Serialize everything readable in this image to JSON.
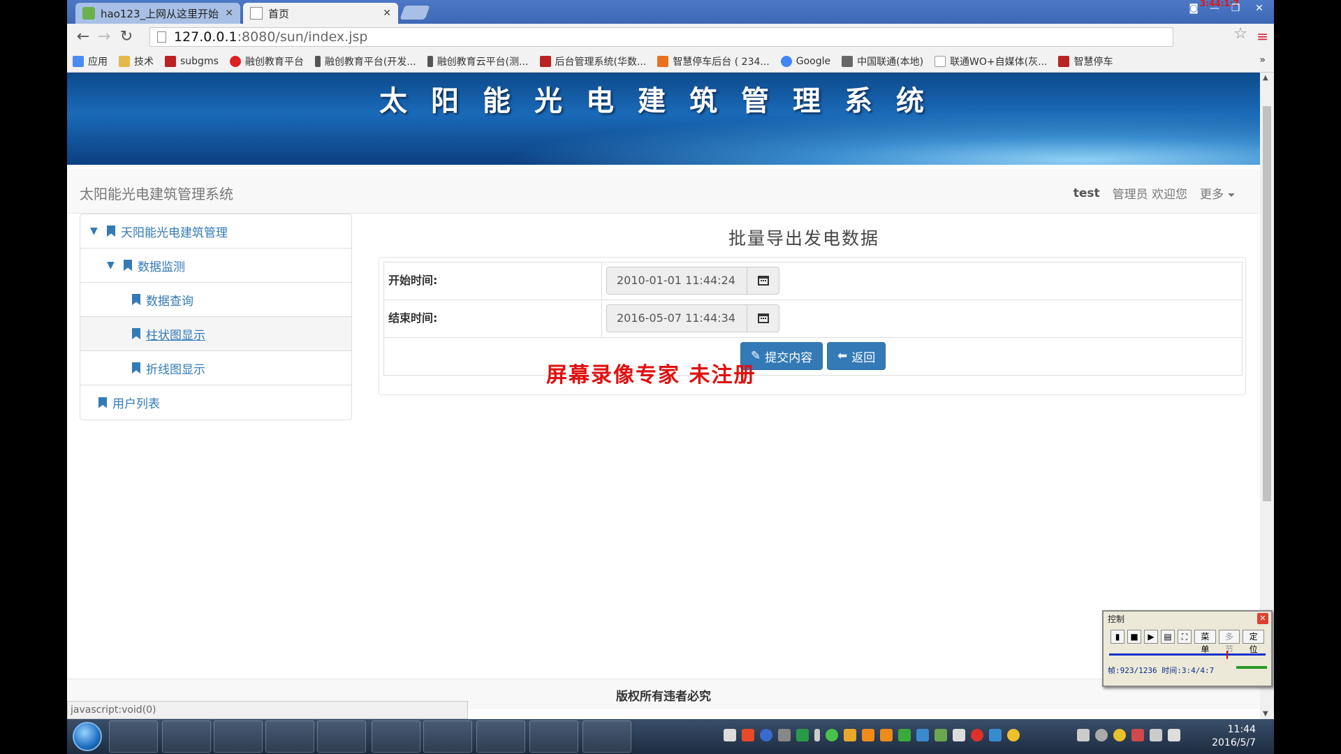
{
  "browser": {
    "tabs": [
      {
        "label": "hao123_上网从这里开始",
        "active": false
      },
      {
        "label": "首页",
        "active": true
      }
    ],
    "recording_time": "3:44:1:7",
    "address": {
      "host": "127.0.0.1",
      "path": ":8080/sun/index.jsp"
    },
    "bookmarks": [
      {
        "label": "应用",
        "color": "#4a8af4"
      },
      {
        "label": "技术",
        "color": "#e6b84a"
      },
      {
        "label": "subgms",
        "color": "#b22"
      },
      {
        "label": "融创教育平台",
        "color": "#d22"
      },
      {
        "label": "融创教育平台(开发...",
        "color": "#555"
      },
      {
        "label": "融创教育云平台(测...",
        "color": "#555"
      },
      {
        "label": "后台管理系统(华数...",
        "color": "#b22"
      },
      {
        "label": "智慧停车后台 ( 234...",
        "color": "#e87020"
      },
      {
        "label": "Google",
        "color": "#4285f4"
      },
      {
        "label": "中国联通(本地)",
        "color": "#666"
      },
      {
        "label": "联通WO+自媒体(灰...",
        "color": "#999"
      },
      {
        "label": "智慧停车",
        "color": "#b22"
      }
    ],
    "bookmarks_more": "»",
    "status_text": "javascript:void(0)"
  },
  "app": {
    "banner_title": "太阳能光电建筑管理系统",
    "brand": "太阳能光电建筑管理系统",
    "user": "test",
    "welcome": "管理员 欢迎您",
    "more": "更多",
    "sidebar": [
      {
        "label": "天阳能光电建筑管理",
        "level": 0,
        "expanded": true
      },
      {
        "label": "数据监测",
        "level": 1,
        "expanded": true
      },
      {
        "label": "数据查询",
        "level": 2
      },
      {
        "label": "柱状图显示",
        "level": 2,
        "hover": true
      },
      {
        "label": "折线图显示",
        "level": 2
      },
      {
        "label": "用户列表",
        "level": 0
      }
    ],
    "page_title": "批量导出发电数据",
    "form": {
      "start_label": "开始时间:",
      "start_value": "2010-01-01 11:44:24",
      "end_label": "结束时间:",
      "end_value": "2016-05-07 11:44:34",
      "submit": "提交内容",
      "back": "返回"
    },
    "footer": "版权所有违者必究",
    "watermark": "屏幕录像专家  未注册"
  },
  "colors": {
    "primary": "#337ab7",
    "banner": "#1a6ab8",
    "watermark": "#e01010"
  },
  "taskbar": {
    "apps": [
      {
        "name": "windows-live-icon",
        "color": "#ff9a2a"
      },
      {
        "name": "android-icon",
        "color": "#4aa82a"
      },
      {
        "name": "chrome-icon",
        "color": "#dd4b39"
      },
      {
        "name": "eclipse-icon",
        "color": "#5a3a8a"
      },
      {
        "name": "explorer-icon",
        "color": "#e8c05a"
      },
      {
        "name": "snail-icon",
        "color": "#e85a4a"
      },
      {
        "name": "editor-icon",
        "color": "#6aa84f"
      },
      {
        "name": "sublime-icon",
        "color": "#2a4a7a"
      },
      {
        "name": "gallery-icon",
        "color": "#aaaaaa"
      },
      {
        "name": "excel-icon",
        "color": "#1f7a3a"
      }
    ],
    "time": "11:44",
    "date": "2016/5/7"
  },
  "recorder": {
    "title": "控制",
    "menu": "菜单",
    "multi": "多节",
    "locate": "定位",
    "info": "帧:923/1236 时间:3:4/4:7",
    "position_fraction": 0.75
  }
}
